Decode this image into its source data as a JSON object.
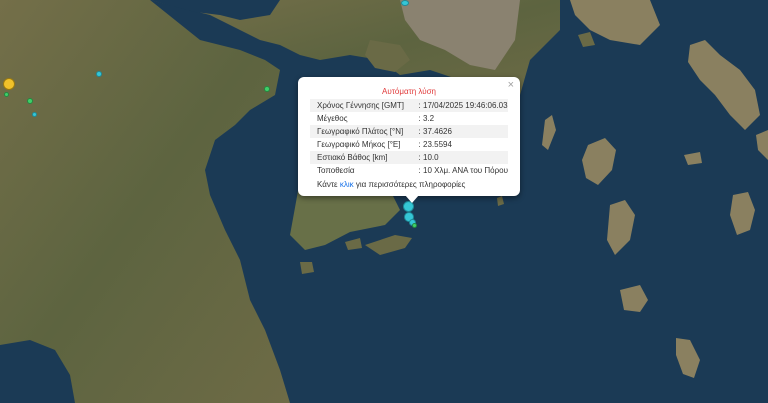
{
  "popup": {
    "title": "Αυτόματη λύση",
    "close": "×",
    "rows": [
      {
        "label": "Χρόνος Γέννησης [GMT]",
        "value": ": 17/04/2025 19:46:06.03"
      },
      {
        "label": "Μέγεθος",
        "value": ": 3.2"
      },
      {
        "label": "Γεωγραφικό Πλάτος [°N]",
        "value": ": 37.4626"
      },
      {
        "label": "Γεωγραφικό Μήκος [°E]",
        "value": ": 23.5594"
      },
      {
        "label": "Εστιακό Βάθος [km]",
        "value": ": 10.0"
      },
      {
        "label": "Τοποθεσία",
        "value": ": 10 Χλμ. ΑΝΑ του Πόρου"
      }
    ],
    "more_prefix": "Κάντε ",
    "more_link": "κλικ",
    "more_suffix": " για περισσότερες πληροφορίες"
  },
  "colors": {
    "sea": "#1b3a55",
    "land": "#6b6a45",
    "marker_cyan": "#35c6d6",
    "marker_yellow": "#f0c22a",
    "marker_green": "#3fcf6a",
    "title_red": "#e03a3a",
    "link_blue": "#1a73e8"
  }
}
